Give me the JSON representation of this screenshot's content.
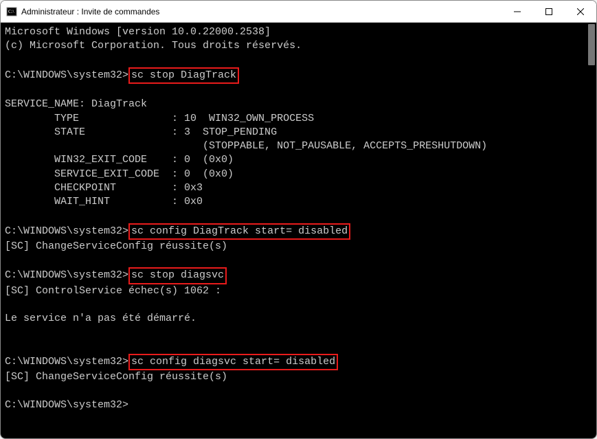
{
  "titlebar": {
    "title": "Administrateur : Invite de commandes"
  },
  "terminal": {
    "banner_line1": "Microsoft Windows [version 10.0.22000.2538]",
    "banner_line2": "(c) Microsoft Corporation. Tous droits réservés.",
    "prompt": "C:\\WINDOWS\\system32>",
    "cmd1": "sc stop DiagTrack",
    "svc_name_line": "SERVICE_NAME: DiagTrack",
    "type_line": "        TYPE               : 10  WIN32_OWN_PROCESS",
    "state_line": "        STATE              : 3  STOP_PENDING",
    "state_flags": "                                (STOPPABLE, NOT_PAUSABLE, ACCEPTS_PRESHUTDOWN)",
    "win32_exit": "        WIN32_EXIT_CODE    : 0  (0x0)",
    "svc_exit": "        SERVICE_EXIT_CODE  : 0  (0x0)",
    "checkpoint": "        CHECKPOINT         : 0x3",
    "wait_hint": "        WAIT_HINT          : 0x0",
    "cmd2": "sc config DiagTrack start= disabled",
    "cmd2_out": "[SC] ChangeServiceConfig réussite(s)",
    "cmd3": "sc stop diagsvc",
    "cmd3_out1": "[SC] ControlService échec(s) 1062 :",
    "cmd3_out2": "Le service n'a pas été démarré.",
    "cmd4": "sc config diagsvc start= disabled",
    "cmd4_out": "[SC] ChangeServiceConfig réussite(s)"
  }
}
